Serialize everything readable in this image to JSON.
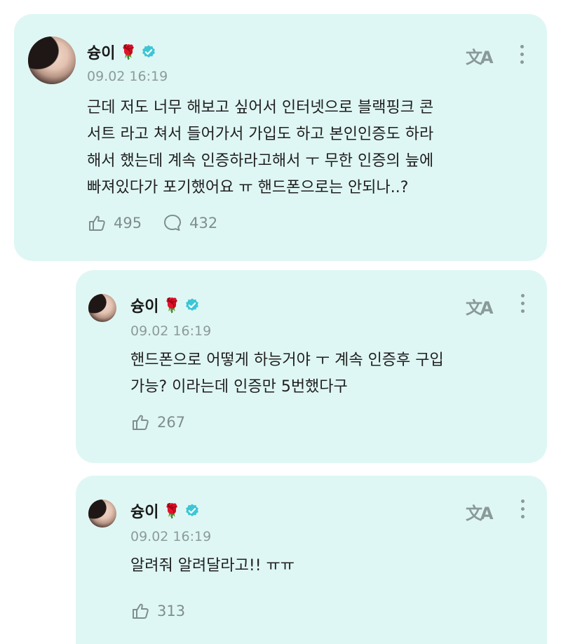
{
  "posts": [
    {
      "author": "슝이",
      "emoji": "🌹",
      "time": "09.02 16:19",
      "lines": [
        "근데 저도 너무 해보고 싶어서 인터넷으로 블랙핑크 콘",
        "서트 라고 쳐서 들어가서 가입도 하고 본인인증도 하라",
        "해서 했는데 계속 인증하라고해서 ㅜ 무한 인증의 늪에",
        "빠져있다가 포기했어요 ㅠ 핸드폰으로는 안되나..?"
      ],
      "likes": "495",
      "comments": "432"
    },
    {
      "author": "슝이",
      "emoji": "🌹",
      "time": "09.02 16:19",
      "lines": [
        "핸드폰으로 어떻게 하능거야 ㅜ 계속 인증후 구입",
        "가능? 이라는데 인증만 5번했다구"
      ],
      "likes": "267"
    },
    {
      "author": "슝이",
      "emoji": "🌹",
      "time": "09.02 16:19",
      "lines": [
        "알려줘 알려달라고!! ㅠㅠ"
      ],
      "likes": "313"
    }
  ],
  "icons": {
    "translate": "文A",
    "like": "like-icon",
    "comment": "comment-icon",
    "more": "more-icon",
    "verified": "verified-badge-icon"
  },
  "colors": {
    "card_bg": "#dff7f4",
    "verified": "#3cc6d6",
    "muted": "#8b9b9a"
  }
}
